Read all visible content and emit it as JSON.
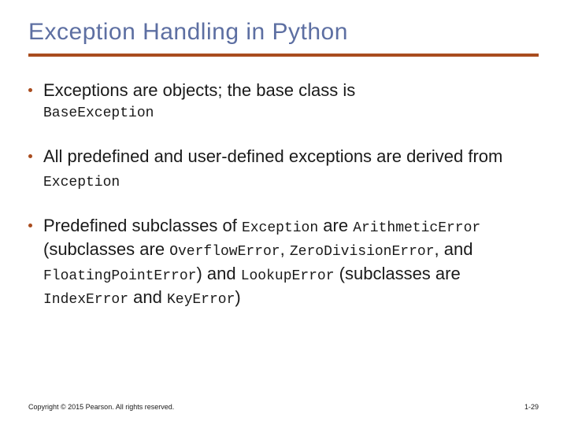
{
  "title": "Exception Handling in Python",
  "bullets": {
    "b1": {
      "text": "Exceptions are objects; the base class is",
      "code1": "BaseException"
    },
    "b2": {
      "pre": "All predefined and user-defined exceptions are derived from ",
      "code1": "Exception"
    },
    "b3": {
      "pre": "Predefined subclasses of ",
      "c1": "Exception",
      "t2": " are ",
      "c2": "ArithmeticError",
      "t3": " (subclasses are ",
      "c3": "OverflowError",
      "t4": ", ",
      "c4": "ZeroDivisionError",
      "t5": ", and ",
      "c5": "FloatingPointError",
      "t6": ") and ",
      "c6": "LookupError",
      "t7": " (subclasses are ",
      "c7": "IndexError",
      "t8": " and ",
      "c8": "KeyError",
      "t9": ")"
    }
  },
  "footer": {
    "copyright": "Copyright © 2015 Pearson. All rights reserved.",
    "page": "1-29"
  }
}
